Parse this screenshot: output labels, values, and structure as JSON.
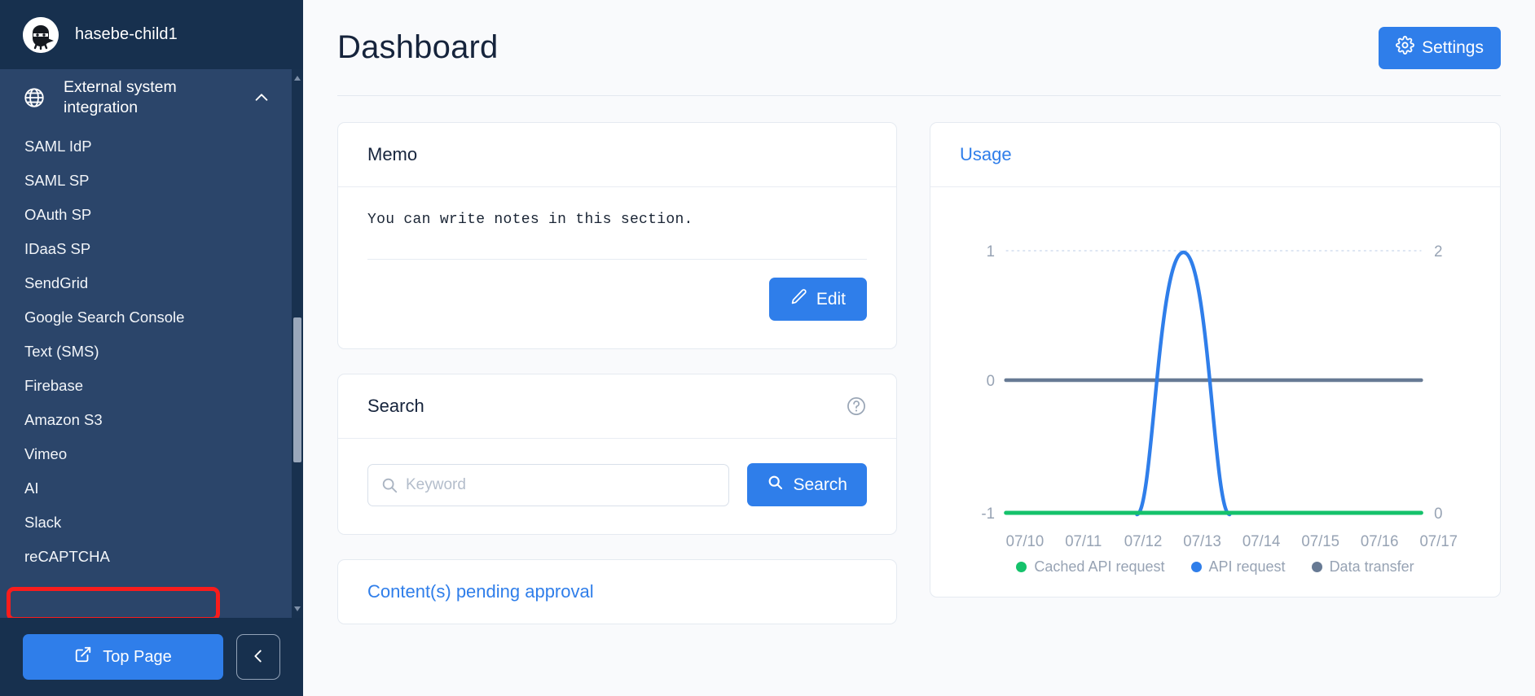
{
  "sidebar": {
    "brand": {
      "name": "hasebe-child1",
      "logo_icon": "ninja-avatar-icon"
    },
    "group": {
      "label": "External system integration",
      "icon": "globe-icon",
      "toggle_icon": "chevron-up-icon"
    },
    "items": [
      {
        "label": "SAML IdP",
        "highlighted": false
      },
      {
        "label": "SAML SP",
        "highlighted": false
      },
      {
        "label": "OAuth SP",
        "highlighted": false
      },
      {
        "label": "IDaaS SP",
        "highlighted": false
      },
      {
        "label": "SendGrid",
        "highlighted": false
      },
      {
        "label": "Google Search Console",
        "highlighted": false
      },
      {
        "label": "Text (SMS)",
        "highlighted": false
      },
      {
        "label": "Firebase",
        "highlighted": false
      },
      {
        "label": "Amazon S3",
        "highlighted": false
      },
      {
        "label": "Vimeo",
        "highlighted": false
      },
      {
        "label": "AI",
        "highlighted": true
      },
      {
        "label": "Slack",
        "highlighted": false
      },
      {
        "label": "reCAPTCHA",
        "highlighted": false
      }
    ],
    "footer": {
      "top_page_label": "Top Page",
      "top_page_icon": "external-link-icon",
      "collapse_icon": "chevron-left-icon"
    },
    "highlight_color": "#f91c1c"
  },
  "header": {
    "title": "Dashboard",
    "settings_label": "Settings",
    "settings_icon": "gear-icon"
  },
  "memo": {
    "title": "Memo",
    "body": "You can write notes in this section.",
    "edit_label": "Edit",
    "edit_icon": "pencil-icon"
  },
  "search": {
    "title": "Search",
    "help_icon": "question-circle-icon",
    "input_value": "",
    "placeholder": "Keyword",
    "search_label": "Search",
    "search_icon": "magnifier-icon"
  },
  "pending": {
    "title": "Content(s) pending approval"
  },
  "usage": {
    "title": "Usage"
  },
  "chart_data": {
    "type": "line",
    "title": "Usage",
    "x": [
      "07/10",
      "07/11",
      "07/12",
      "07/13",
      "07/14",
      "07/15",
      "07/16",
      "07/17"
    ],
    "left_axis_ticks": [
      "1",
      "0",
      "-1"
    ],
    "right_axis_ticks": [
      "2",
      "0"
    ],
    "ylim_left": [
      -1,
      1
    ],
    "ylim_right": [
      0,
      2
    ],
    "grid": true,
    "legend_position": "bottom",
    "series": [
      {
        "name": "Cached API request",
        "color": "#15c26b",
        "axis": "left",
        "values": [
          -1,
          -1,
          -1,
          -1,
          -1,
          -1,
          -1,
          -1
        ]
      },
      {
        "name": "API request",
        "color": "#2f7eea",
        "axis": "left",
        "values": [
          -1,
          -1,
          -1,
          1,
          -1,
          -1,
          -1,
          -1
        ]
      },
      {
        "name": "Data transfer",
        "color": "#677a94",
        "axis": "right",
        "values": [
          1,
          1,
          1,
          1,
          1,
          1,
          1,
          1
        ]
      }
    ]
  },
  "colors": {
    "accent": "#2f7eea",
    "sidebar": "#18314f",
    "sidebar_panel": "#2b456a",
    "green": "#15c26b",
    "slate": "#677a94",
    "highlight": "#f91c1c"
  }
}
